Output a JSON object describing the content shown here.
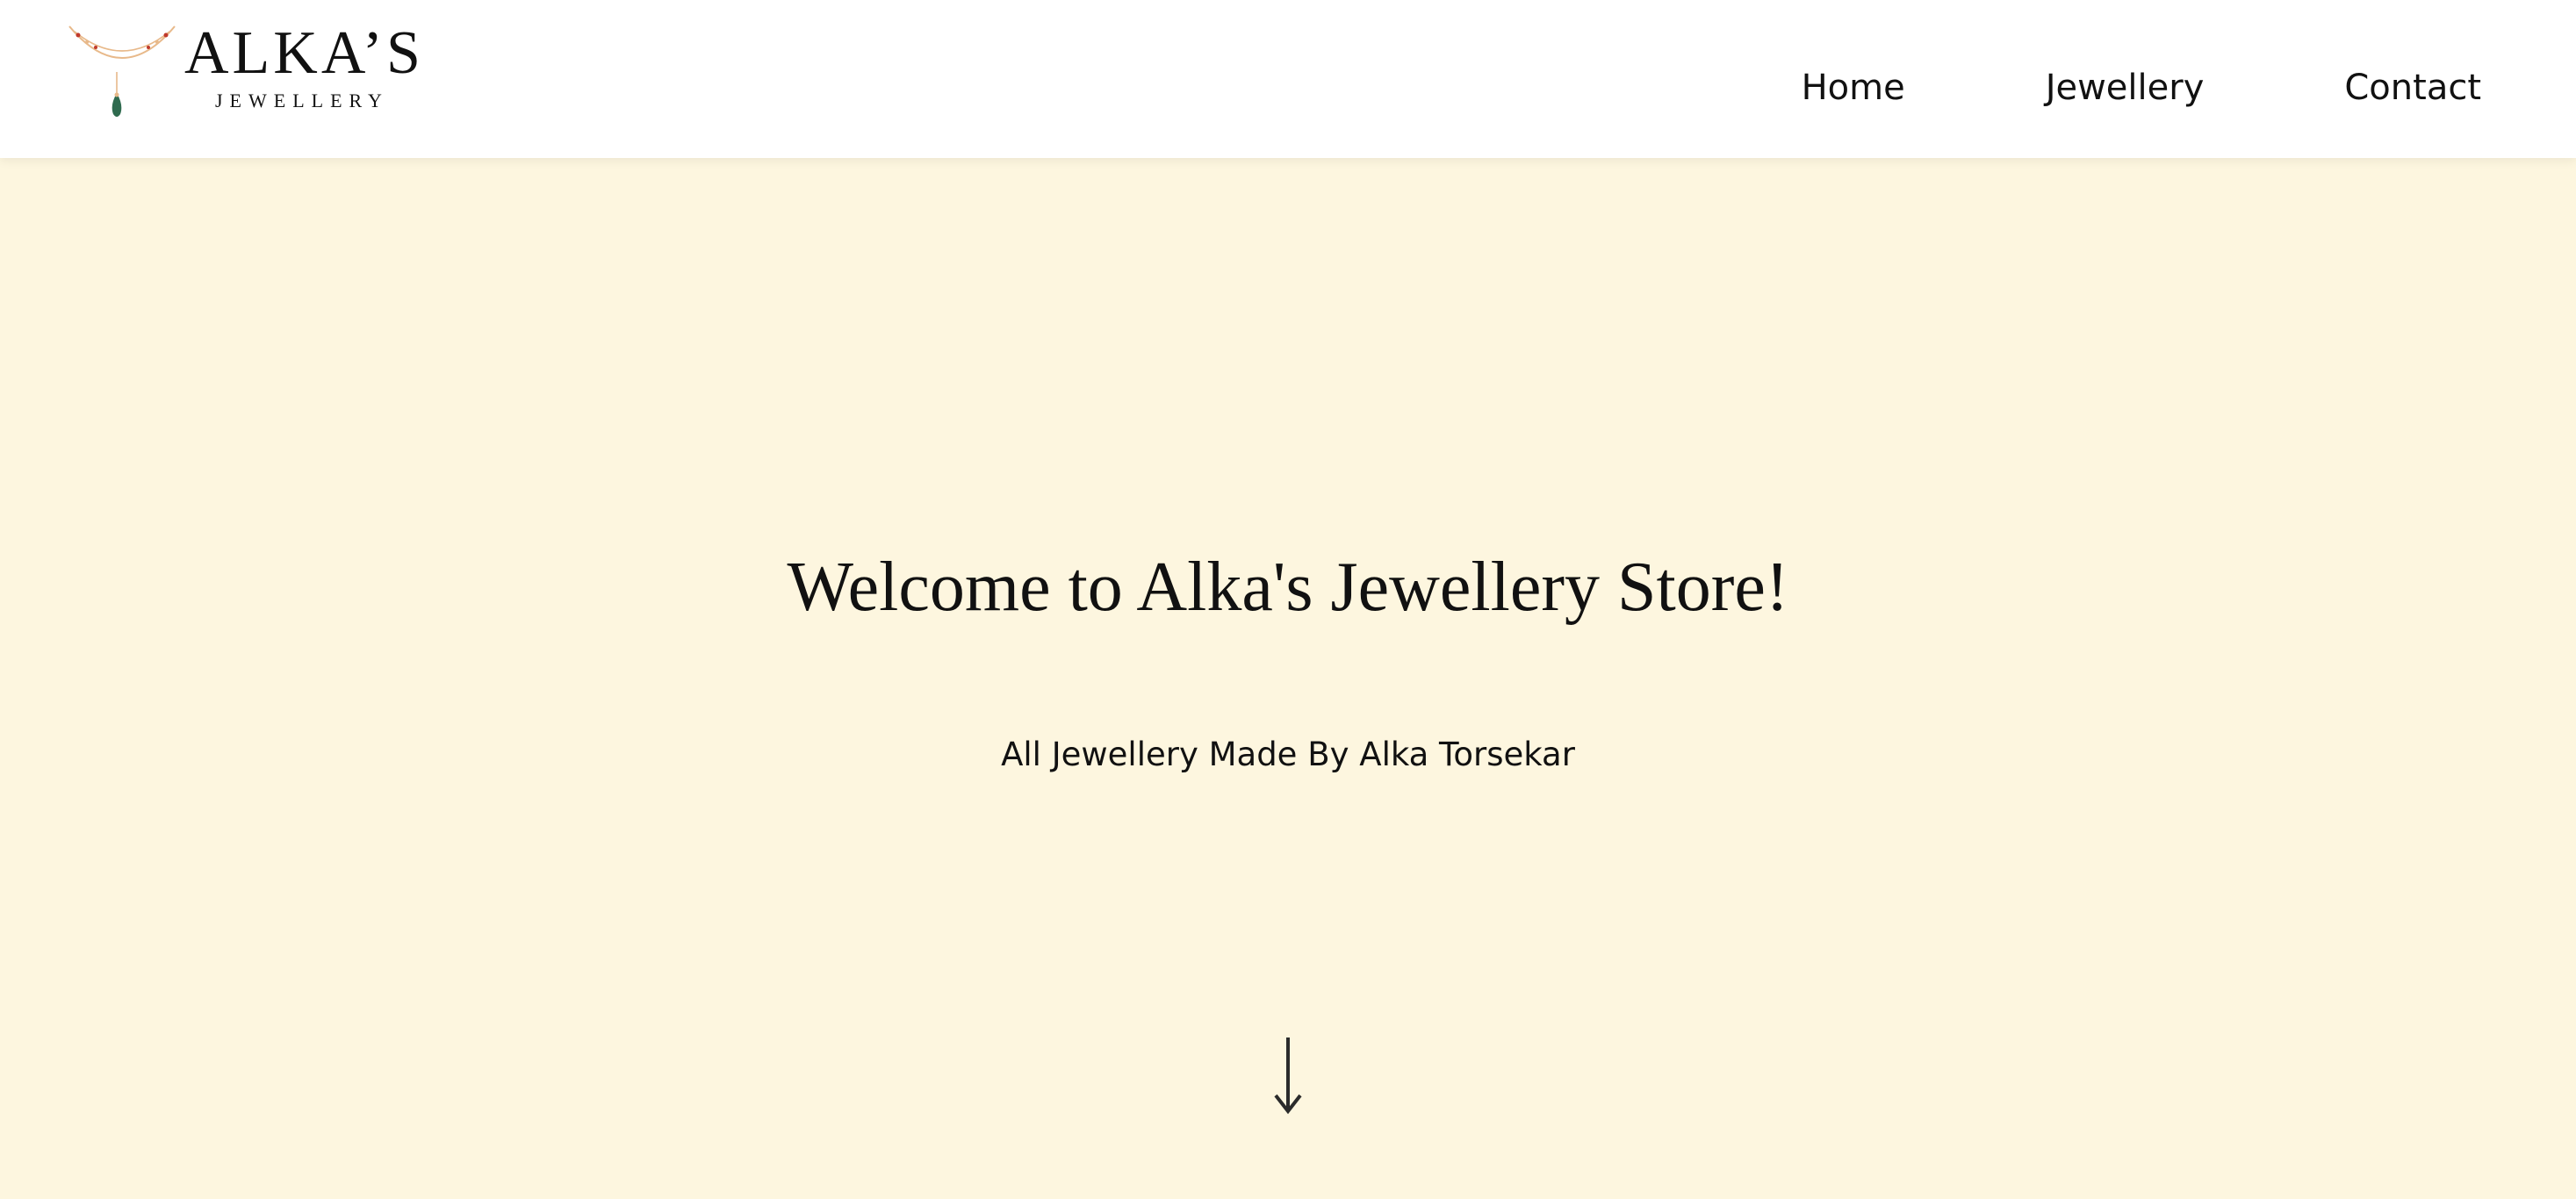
{
  "brand": {
    "name": "ALKA’S",
    "tagline": "JEWELLERY",
    "colors": {
      "necklace_gold": "#e8b98a",
      "pendant_green": "#2f6b4f",
      "beads_red": "#c0392b"
    }
  },
  "nav": {
    "items": [
      {
        "label": "Home"
      },
      {
        "label": "Jewellery"
      },
      {
        "label": "Contact"
      }
    ]
  },
  "hero": {
    "title": "Welcome to Alka's Jewellery Store!",
    "subtitle": "All Jewellery Made By Alka Torsekar",
    "scroll_icon": "arrow-down-icon",
    "background_color": "#fdf6df"
  }
}
